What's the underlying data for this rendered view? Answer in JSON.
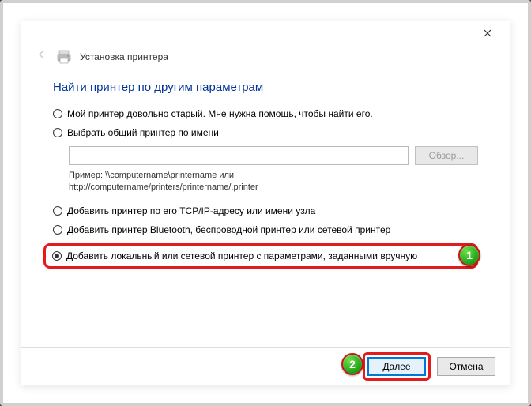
{
  "header": {
    "title": "Установка принтера"
  },
  "main": {
    "heading": "Найти принтер по другим параметрам"
  },
  "options": {
    "opt1": "Мой принтер довольно старый. Мне нужна помощь, чтобы найти его.",
    "opt2": "Выбрать общий принтер по имени",
    "browse_label": "Обзор...",
    "example_line1": "Пример: \\\\computername\\printername или",
    "example_line2": "http://computername/printers/printername/.printer",
    "opt3": "Добавить принтер по его TCP/IP-адресу или имени узла",
    "opt4": "Добавить принтер Bluetooth, беспроводной принтер или сетевой принтер",
    "opt5": "Добавить локальный или сетевой принтер с параметрами, заданными вручную"
  },
  "footer": {
    "next": "Далее",
    "cancel": "Отмена"
  },
  "badges": {
    "one": "1",
    "two": "2"
  }
}
